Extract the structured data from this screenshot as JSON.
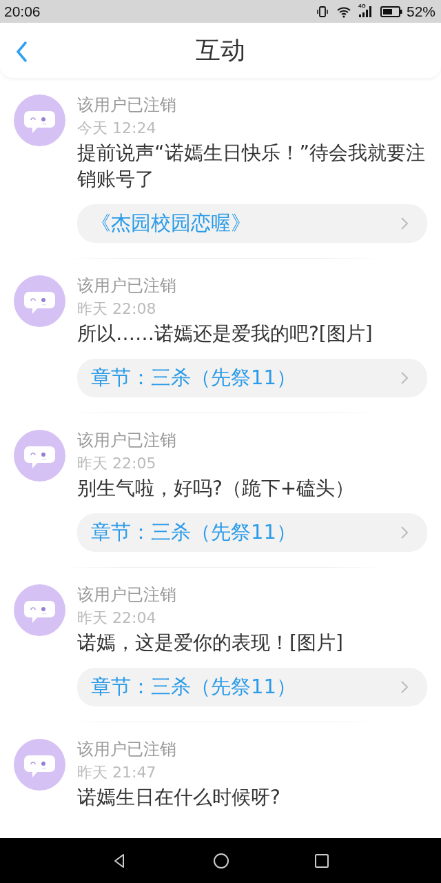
{
  "status_bar": {
    "time": "20:06",
    "network": "4G",
    "battery": "52%"
  },
  "header": {
    "title": "互动"
  },
  "comments": [
    {
      "user": "该用户已注销",
      "time": "今天 12:24",
      "text": "提前说声“诺嫣生日快乐！”待会我就要注销账号了",
      "link": "《杰园校园恋喔》"
    },
    {
      "user": "该用户已注销",
      "time": "昨天 22:08",
      "text": "所以……诺嫣还是爱我的吧?[图片]",
      "link": "章节：三杀（先祭11）"
    },
    {
      "user": "该用户已注销",
      "time": "昨天 22:05",
      "text": "别生气啦，好吗?（跪下+磕头）",
      "link": "章节：三杀（先祭11）"
    },
    {
      "user": "该用户已注销",
      "time": "昨天 22:04",
      "text": "诺嫣，这是爱你的表现！[图片]",
      "link": "章节：三杀（先祭11）"
    },
    {
      "user": "该用户已注销",
      "time": "昨天 21:47",
      "text": "诺嫣生日在什么时候呀?"
    }
  ]
}
